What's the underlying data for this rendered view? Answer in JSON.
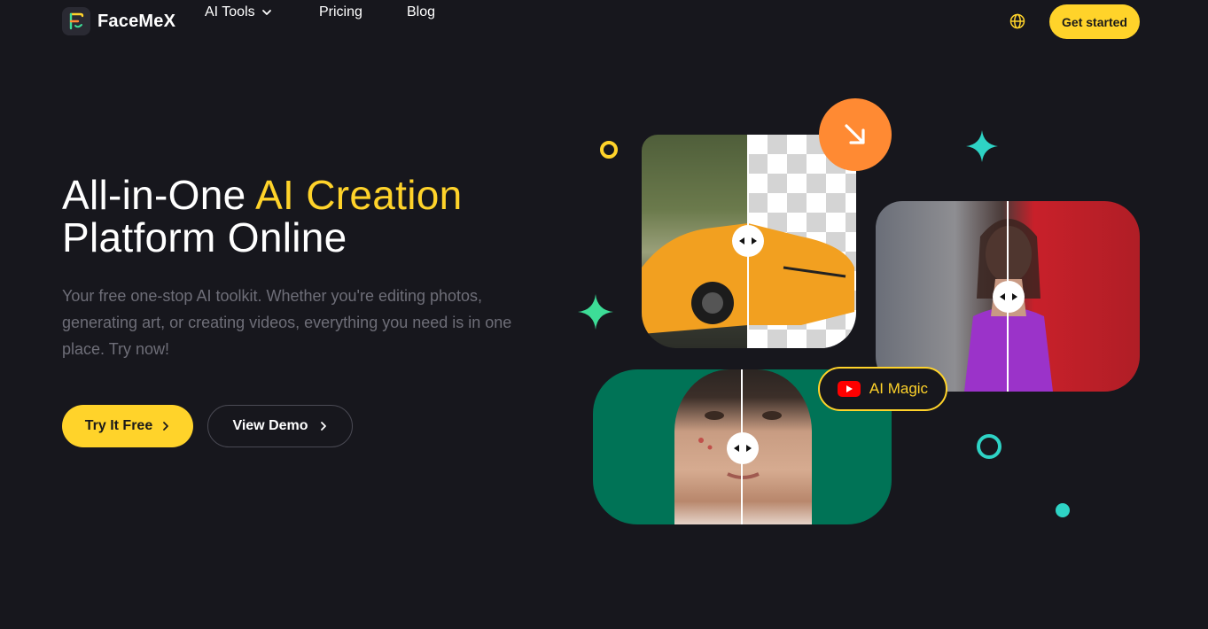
{
  "header": {
    "logo_text": "FaceMeX",
    "nav": {
      "ai_tools": "AI Tools",
      "pricing": "Pricing",
      "blog": "Blog"
    },
    "cta": "Get started"
  },
  "hero": {
    "title_part1": "All-in-One ",
    "title_accent": "AI Creation",
    "title_part2": "Platform Online",
    "subtext": "Your free one-stop AI toolkit. Whether you're editing photos, generating art, or creating videos, everything you need is in one place. Try now!",
    "primary_button": "Try It Free",
    "secondary_button": "View Demo"
  },
  "collage": {
    "badge_label": "AI Magic",
    "icons": {
      "globe": "globe-icon",
      "arrow": "arrow-down-right-icon",
      "video": "youtube-icon",
      "compare": "compare-arrows-icon"
    }
  },
  "colors": {
    "background": "#17171d",
    "accent_yellow": "#ffd32a",
    "accent_orange": "#ff8a33",
    "accent_green": "#3ddc97",
    "accent_teal": "#2ed3c5",
    "face_bg": "#007356"
  }
}
